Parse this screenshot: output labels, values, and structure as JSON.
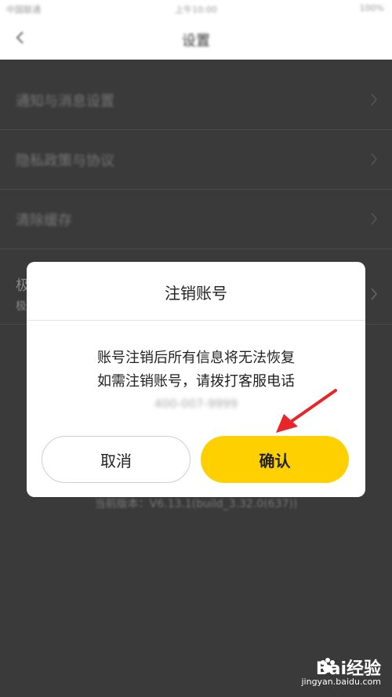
{
  "statusbar": {
    "left": "中国联通",
    "time": "上午10:00",
    "right": "100%"
  },
  "navbar": {
    "title": "设置"
  },
  "settings": {
    "rows": [
      {
        "label": "通知与消息设置"
      },
      {
        "label": "隐私政策与协议"
      },
      {
        "label": "清除缓存"
      },
      {
        "label": "极",
        "sublabel": "极"
      }
    ],
    "version": "当前版本：V6.13.1(build_3.32.0(637))"
  },
  "dialog": {
    "title": "注销账号",
    "message_line1": "账号注销后所有信息将无法恢复",
    "message_line2": "如需注销账号，请拨打客服电话",
    "phone": "400-007-9999",
    "cancel_label": "取消",
    "confirm_label": "确认"
  },
  "watermark": {
    "logo": "Bai经验",
    "url": "jingyan.baidu.com"
  },
  "colors": {
    "accent": "#ffd000",
    "annotation_arrow": "#e8262a",
    "overlay": "#3a3a3a"
  }
}
